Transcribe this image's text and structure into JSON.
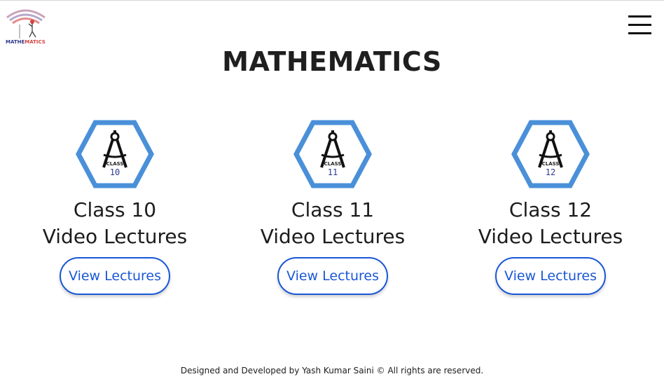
{
  "header": {
    "logo_text_a": "MATHE",
    "logo_text_b": "MATICS",
    "menu_icon": "hamburger-icon"
  },
  "main": {
    "title": "MATHEMATICS",
    "cards": [
      {
        "badge_label": "CLASS",
        "badge_number": "10",
        "title_line1": "Class 10",
        "title_line2": "Video Lectures",
        "button_label": "View Lectures",
        "icon": "compass-icon"
      },
      {
        "badge_label": "CLASS",
        "badge_number": "11",
        "title_line1": "Class 11",
        "title_line2": "Video Lectures",
        "button_label": "View Lectures",
        "icon": "compass-icon"
      },
      {
        "badge_label": "CLASS",
        "badge_number": "12",
        "title_line1": "Class 12",
        "title_line2": "Video Lectures",
        "button_label": "View Lectures",
        "icon": "compass-icon"
      }
    ]
  },
  "footer": {
    "text": "Designed and Developed by Yash Kumar Saini © All rights are reserved."
  },
  "colors": {
    "accent": "#1a57d6",
    "badge_border": "#4a90d9",
    "logo_blue": "#2d3a8c",
    "logo_red": "#d8433f"
  }
}
